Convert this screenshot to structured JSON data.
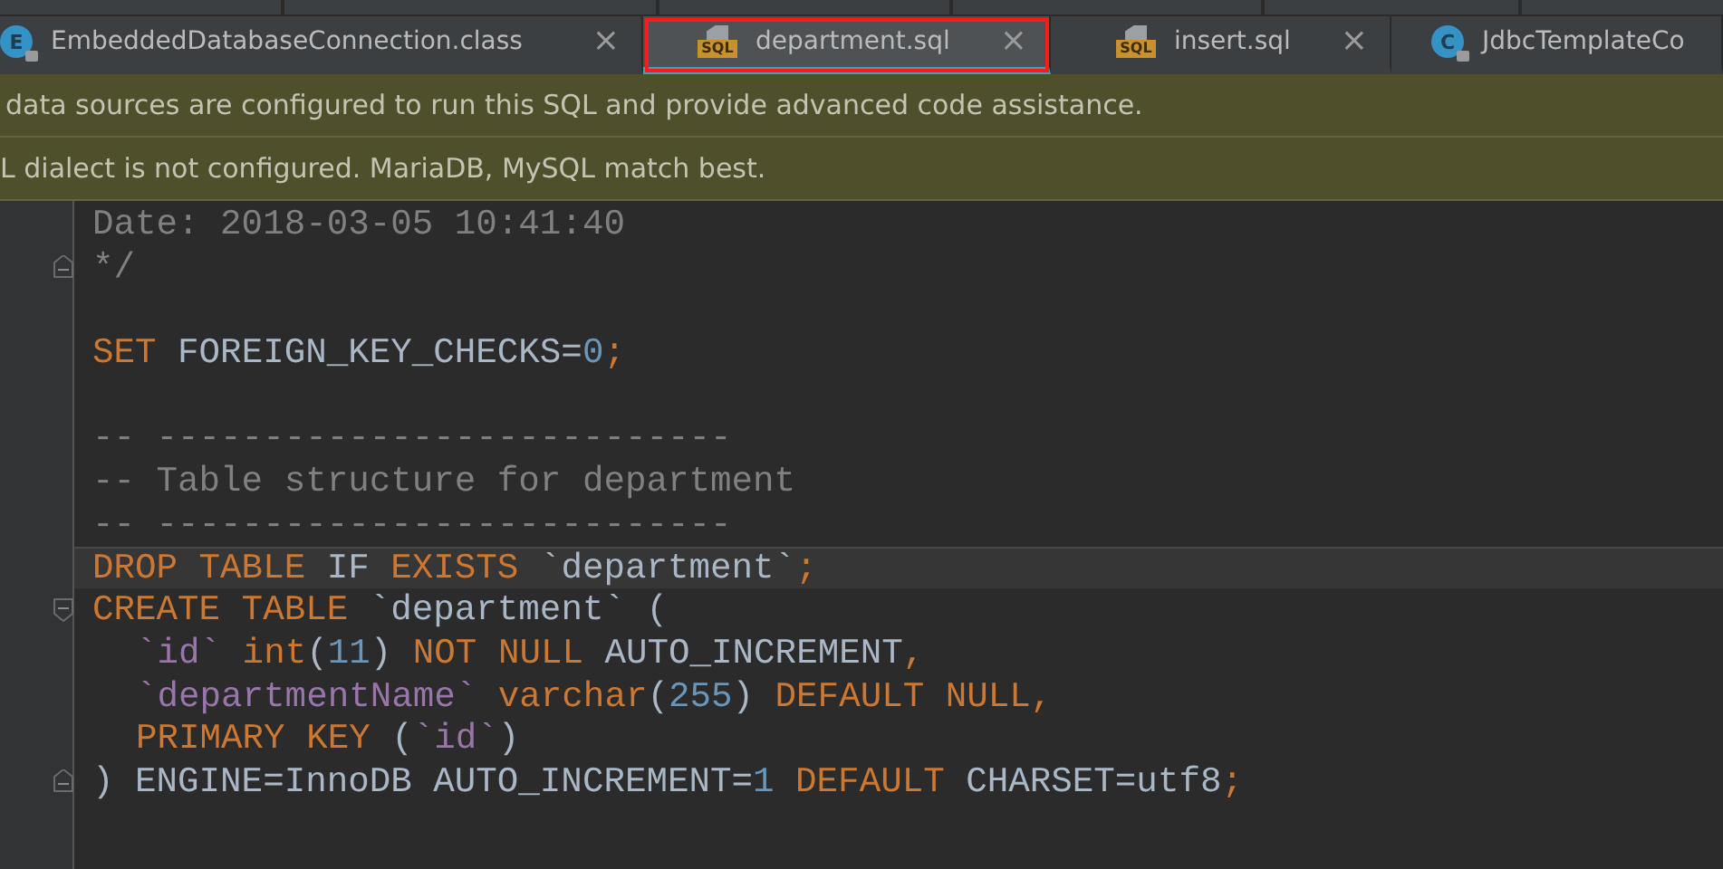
{
  "tabs": [
    {
      "label": "EmbeddedDatabaseConnection.class",
      "kind": "class",
      "badge": "E",
      "selected": false,
      "highlighted": false,
      "close": "×"
    },
    {
      "label": "department.sql",
      "kind": "sql",
      "badge": "SQL",
      "selected": true,
      "highlighted": true,
      "close": "×"
    },
    {
      "label": "insert.sql",
      "kind": "sql",
      "badge": "SQL",
      "selected": false,
      "highlighted": false,
      "close": "×"
    },
    {
      "label": "JdbcTemplateCo",
      "kind": "class",
      "badge": "C",
      "selected": false,
      "highlighted": false
    }
  ],
  "banners": [
    {
      "text": "data sources are configured to run this SQL and provide advanced code assistance."
    },
    {
      "text": "L dialect is not configured. MariaDB, MySQL match best."
    }
  ],
  "code_lines": [
    {
      "kind": "code",
      "tokens": [
        {
          "kind": "comment",
          "text": "Date: 2018-03-05 10:41:40"
        }
      ]
    },
    {
      "kind": "code",
      "fold_end": true,
      "tokens": [
        {
          "kind": "comment",
          "text": "*/"
        }
      ]
    },
    {
      "kind": "blank"
    },
    {
      "kind": "code",
      "tokens": [
        {
          "kind": "keyword",
          "text": "SET"
        },
        {
          "kind": "plain",
          "text": " FOREIGN_KEY_CHECKS="
        },
        {
          "kind": "number",
          "text": "0"
        },
        {
          "kind": "keyword",
          "text": ";"
        }
      ]
    },
    {
      "kind": "blank"
    },
    {
      "kind": "code",
      "tokens": [
        {
          "kind": "comment",
          "text": "-- ---------------------------"
        }
      ]
    },
    {
      "kind": "code",
      "tokens": [
        {
          "kind": "comment",
          "text": "-- Table structure for department"
        }
      ]
    },
    {
      "kind": "code",
      "tokens": [
        {
          "kind": "comment",
          "text": "-- ---------------------------"
        }
      ]
    },
    {
      "kind": "code",
      "current": true,
      "tokens": [
        {
          "kind": "keyword",
          "text": "DROP TABLE"
        },
        {
          "kind": "plain",
          "text": " IF "
        },
        {
          "kind": "keyword",
          "text": "EXISTS"
        },
        {
          "kind": "plain",
          "text": " `department`"
        },
        {
          "kind": "keyword",
          "text": ";"
        }
      ]
    },
    {
      "kind": "code",
      "fold_start": true,
      "tokens": [
        {
          "kind": "keyword",
          "text": "CREATE TABLE"
        },
        {
          "kind": "plain",
          "text": " `department` ("
        }
      ]
    },
    {
      "kind": "code",
      "indented": true,
      "tokens": [
        {
          "kind": "ident",
          "text": "`id`"
        },
        {
          "kind": "keyword",
          "text": " int"
        },
        {
          "kind": "plain",
          "text": "("
        },
        {
          "kind": "number",
          "text": "11"
        },
        {
          "kind": "plain",
          "text": ")"
        },
        {
          "kind": "keyword",
          "text": " NOT NULL"
        },
        {
          "kind": "plain",
          "text": " AUTO_INCREMENT"
        },
        {
          "kind": "keyword",
          "text": ","
        }
      ]
    },
    {
      "kind": "code",
      "indented": true,
      "tokens": [
        {
          "kind": "ident",
          "text": "`departmentName`"
        },
        {
          "kind": "keyword",
          "text": " varchar"
        },
        {
          "kind": "plain",
          "text": "("
        },
        {
          "kind": "number",
          "text": "255"
        },
        {
          "kind": "plain",
          "text": ")"
        },
        {
          "kind": "keyword",
          "text": " DEFAULT NULL,"
        }
      ]
    },
    {
      "kind": "code",
      "indented": true,
      "tokens": [
        {
          "kind": "keyword",
          "text": "PRIMARY KEY"
        },
        {
          "kind": "plain",
          "text": " ("
        },
        {
          "kind": "ident",
          "text": "`id`"
        },
        {
          "kind": "plain",
          "text": ")"
        }
      ]
    },
    {
      "kind": "code",
      "fold_end": true,
      "tokens": [
        {
          "kind": "plain",
          "text": ") ENGINE=InnoDB AUTO_INCREMENT="
        },
        {
          "kind": "number",
          "text": "1"
        },
        {
          "kind": "keyword",
          "text": " DEFAULT"
        },
        {
          "kind": "plain",
          "text": " CHARSET=utf8"
        },
        {
          "kind": "keyword",
          "text": ";"
        }
      ]
    }
  ]
}
